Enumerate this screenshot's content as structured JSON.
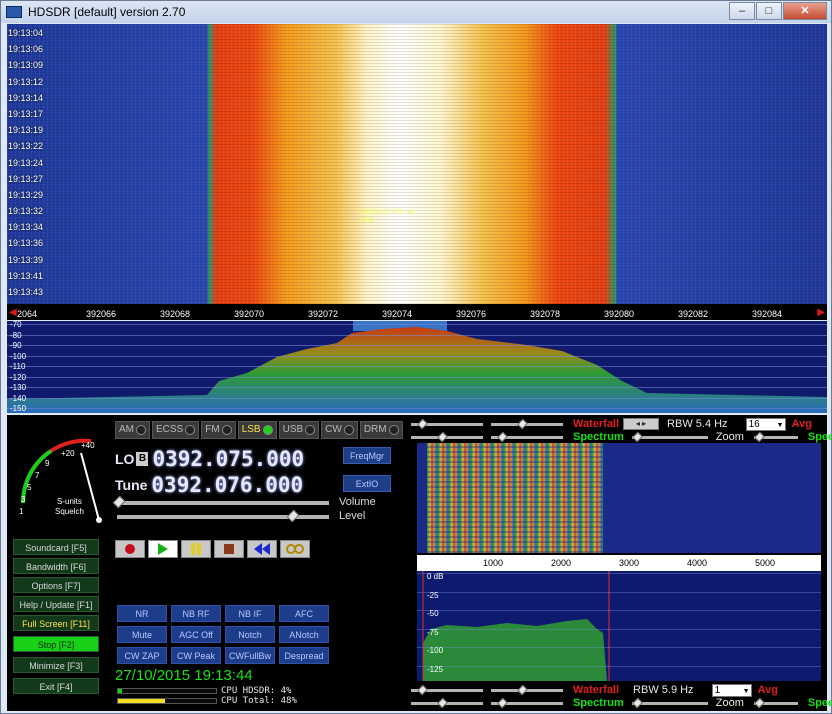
{
  "window": {
    "title": "HDSDR [default]  version 2.70",
    "minimize": "–",
    "maximize": "□",
    "close": "✕"
  },
  "waterfall": {
    "timestamps": [
      "19:13:04",
      "19:13:06",
      "19:13:09",
      "19:13:12",
      "19:13:14",
      "19:13:17",
      "19:13:19",
      "19:13:22",
      "19:13:24",
      "19:13:27",
      "19:13:29",
      "19:13:32",
      "19:13:34",
      "19:13:36",
      "19:13:39",
      "19:13:41",
      "19:13:43"
    ],
    "marker_line1": "392074,0,7691 Hz",
    "marker_line2": "-0Hz"
  },
  "freq_scale": {
    "ticks": [
      "2064",
      "392066",
      "392068",
      "392070",
      "392072",
      "392074",
      "392076",
      "392078",
      "392080",
      "392082",
      "392084"
    ]
  },
  "spectrum": {
    "db_labels": [
      "-70",
      "-80",
      "-90",
      "-100",
      "-110",
      "-120",
      "-130",
      "-140",
      "-150"
    ]
  },
  "smeter": {
    "labels": [
      "+40",
      "+20",
      "9",
      "7",
      "5",
      "3",
      "1"
    ],
    "title": "S-units",
    "subtitle": "Squelch"
  },
  "modes": [
    {
      "label": "AM",
      "active": false
    },
    {
      "label": "ECSS",
      "active": false
    },
    {
      "label": "FM",
      "active": false
    },
    {
      "label": "LSB",
      "active": true
    },
    {
      "label": "USB",
      "active": false
    },
    {
      "label": "CW",
      "active": false
    },
    {
      "label": "DRM",
      "active": false
    }
  ],
  "lo": {
    "label": "LO",
    "badge": "B",
    "value": "0392.075.000"
  },
  "tune": {
    "label": "Tune",
    "value": "0392.076.000"
  },
  "side_buttons": {
    "freqmgr": "FreqMgr",
    "extio": "ExtIO"
  },
  "sliders": {
    "volume": "Volume",
    "level": "Level"
  },
  "left_buttons": [
    {
      "label": "Soundcard [F5]"
    },
    {
      "label": "Bandwidth [F6]"
    },
    {
      "label": "Options  [F7]"
    },
    {
      "label": "Help / Update [F1]"
    },
    {
      "label": "Full Screen [F11]"
    },
    {
      "label": "Stop    [F2]"
    },
    {
      "label": "Minimize [F3]"
    },
    {
      "label": "Exit     [F4]"
    }
  ],
  "dsp_buttons": [
    "NR",
    "NB RF",
    "NB IF",
    "AFC",
    "Mute",
    "AGC Off",
    "Notch",
    "ANotch",
    "CW ZAP",
    "CW Peak",
    "CWFullBw",
    "Despread"
  ],
  "status": {
    "datetime": "27/10/2015 19:13:44",
    "cpu_hdsdr": "CPU HDSDR:  4%",
    "cpu_total": "CPU Total: 48%",
    "cpu_hdsdr_fraction": 0.04,
    "cpu_total_fraction": 0.48,
    "cpu_hdsdr_color": "#19d019",
    "cpu_total_color": "#f0e020"
  },
  "audio_top": {
    "waterfall_label": "Waterfall",
    "spectrum_label": "Spectrum",
    "rbw": "RBW  5.4 Hz",
    "avg_value": "16",
    "avg_label": "Avg",
    "zoom_label": "Zoom",
    "speed_label": "Speed"
  },
  "audio_scale": {
    "ticks": [
      "1000",
      "2000",
      "3000",
      "4000",
      "5000"
    ]
  },
  "audio_spectrum": {
    "db_labels": [
      "0 dB",
      "-25",
      "-50",
      "-75",
      "-100",
      "-125"
    ]
  },
  "audio_bottom": {
    "waterfall_label": "Waterfall",
    "spectrum_label": "Spectrum",
    "rbw": "RBW  5.9 Hz",
    "avg_value": "1",
    "avg_label": "Avg",
    "zoom_label": "Zoom",
    "speed_label": "Speed"
  },
  "colors": {
    "lsb_active": "#ffe046",
    "stop_bg": "#19d019",
    "waterfall_label": "#e02020",
    "spectrum_label": "#19e019"
  }
}
